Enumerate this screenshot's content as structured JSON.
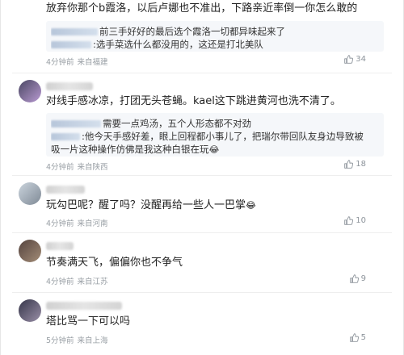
{
  "comments": [
    {
      "text": "放弃你那个b霞洛，以后卢娜也不准出，下路亲近率倒一你怎么敢的",
      "replies": [
        {
          "text": "前三手好好的最后选个霞洛一切都异味起来了"
        },
        {
          "text": ":选手菜选什么都没用的，这还是打北美队"
        }
      ],
      "time": "4分钟前",
      "location": "来自福建",
      "likes": "34"
    },
    {
      "text": "对线手感冰凉，打团无头苍蝇。kael这下跳进黄河也洗不清了。",
      "replies": [
        {
          "text": "需要一点鸡汤，五个人形态都不对劲"
        },
        {
          "text": ":他今天手感好差，眼上回程都小事儿了，把瑞尔带回队友身边导致被"
        },
        {
          "text": "吸一片这种操作仿佛是我这种白银在玩"
        }
      ],
      "time": "4分钟前",
      "location": "来自陕西",
      "likes": "18"
    },
    {
      "text": "玩勾巴呢？醒了吗？没醒再给一些人一巴掌",
      "time": "4分钟前",
      "location": "来自河南",
      "likes": "10"
    },
    {
      "text": "节奏满天飞，偏偏你也不争气",
      "time": "4分钟前",
      "location": "来自江苏",
      "likes": "9"
    },
    {
      "text": "塔比骂一下可以吗",
      "time": "5分钟前",
      "location": "来自上海",
      "likes": "5"
    }
  ],
  "icons": {
    "like": "thumbs-up-icon",
    "emoji": "laughing-tears-emoji"
  },
  "colors": {
    "meta": "#9aa0a6",
    "quote_bg": "#f5f7fa"
  }
}
